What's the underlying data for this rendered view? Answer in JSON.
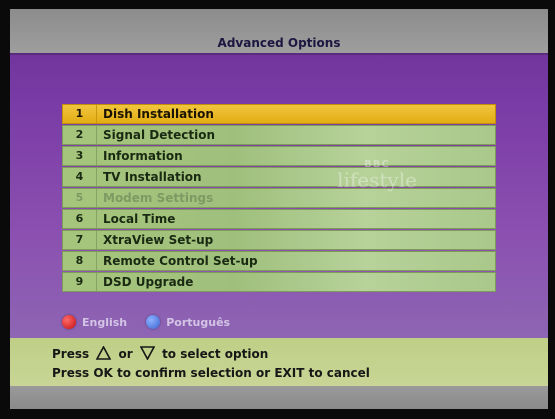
{
  "screen": {
    "title": "Advanced Options"
  },
  "menu": {
    "selected_index": 0,
    "items": [
      {
        "num": "1",
        "label": "Dish Installation",
        "state": "selected"
      },
      {
        "num": "2",
        "label": "Signal Detection",
        "state": "normal"
      },
      {
        "num": "3",
        "label": "Information",
        "state": "normal"
      },
      {
        "num": "4",
        "label": "TV Installation",
        "state": "normal"
      },
      {
        "num": "5",
        "label": "Modem Settings",
        "state": "disabled"
      },
      {
        "num": "6",
        "label": "Local Time",
        "state": "normal"
      },
      {
        "num": "7",
        "label": "XtraView Set-up",
        "state": "normal"
      },
      {
        "num": "8",
        "label": "Remote Control Set-up",
        "state": "normal"
      },
      {
        "num": "9",
        "label": "DSD Upgrade",
        "state": "normal"
      }
    ]
  },
  "watermark": {
    "brand": "BBC",
    "word": "lifestyle"
  },
  "languages": [
    {
      "label": "English",
      "color": "#d31616",
      "icon": "red-button-icon"
    },
    {
      "label": "Português",
      "color": "#4a73db",
      "icon": "blue-button-icon"
    }
  ],
  "help": {
    "line1_prefix": "Press",
    "line1_mid": "or",
    "line1_suffix": "to select option",
    "line2": "Press OK to confirm selection or EXIT to cancel"
  },
  "colors": {
    "accent": "#e8b31e",
    "background": "#7a3ca6",
    "menu_row": "#a6c57c"
  }
}
